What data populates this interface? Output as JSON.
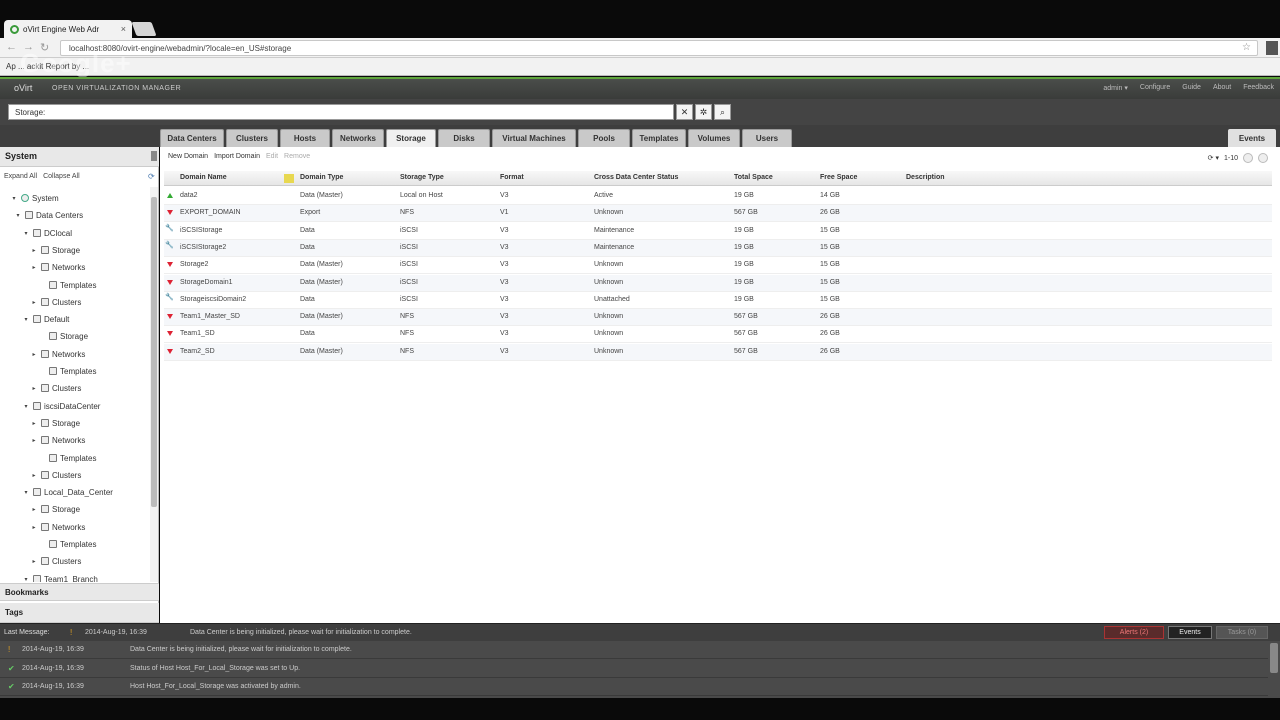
{
  "browser": {
    "tab_title": "oVirt Engine Web Adr",
    "tab_close": "×",
    "url": "localhost:8080/ovirt-engine/webadmin/?locale=en_US#storage",
    "bookmark_bar_text": "Ap  ...  ackit Report by ...",
    "overlay_text": "Google+"
  },
  "header": {
    "logo": "oVirt",
    "product": "OPEN VIRTUALIZATION MANAGER",
    "links": [
      "admin ▾",
      "Configure",
      "Guide",
      "About",
      "Feedback"
    ]
  },
  "search": {
    "value": "Storage:",
    "clear": "✕",
    "bookmark": "✲",
    "go": "⌕"
  },
  "main_tabs": [
    "Data Centers",
    "Clusters",
    "Hosts",
    "Networks",
    "Storage",
    "Disks",
    "Virtual Machines",
    "Pools",
    "Templates",
    "Volumes",
    "Users"
  ],
  "events_tab": "Events",
  "left": {
    "title": "System",
    "expand_all": "Expand All",
    "collapse_all": "Collapse All",
    "tree": [
      {
        "label": "System",
        "arrow": "▾"
      },
      {
        "label": "Data Centers",
        "arrow": "▾"
      },
      {
        "label": "DClocal",
        "arrow": "▾"
      },
      {
        "label": "Storage",
        "arrow": "▸"
      },
      {
        "label": "Networks",
        "arrow": "▸"
      },
      {
        "label": "Templates",
        "arrow": ""
      },
      {
        "label": "Clusters",
        "arrow": "▸"
      },
      {
        "label": "Default",
        "arrow": "▾"
      },
      {
        "label": "Storage",
        "arrow": ""
      },
      {
        "label": "Networks",
        "arrow": "▸"
      },
      {
        "label": "Templates",
        "arrow": ""
      },
      {
        "label": "Clusters",
        "arrow": "▸"
      },
      {
        "label": "iscsiDataCenter",
        "arrow": "▾"
      },
      {
        "label": "Storage",
        "arrow": "▸"
      },
      {
        "label": "Networks",
        "arrow": "▸"
      },
      {
        "label": "Templates",
        "arrow": ""
      },
      {
        "label": "Clusters",
        "arrow": "▸"
      },
      {
        "label": "Local_Data_Center",
        "arrow": "▾"
      },
      {
        "label": "Storage",
        "arrow": "▸"
      },
      {
        "label": "Networks",
        "arrow": "▸"
      },
      {
        "label": "Templates",
        "arrow": ""
      },
      {
        "label": "Clusters",
        "arrow": "▸"
      },
      {
        "label": "Team1_Branch",
        "arrow": "▾"
      }
    ],
    "bookmarks": "Bookmarks",
    "tags": "Tags"
  },
  "actions": {
    "new_domain": "New Domain",
    "import_domain": "Import Domain",
    "edit": "Edit",
    "remove": "Remove"
  },
  "pager": {
    "refresh": "⟳ ▾",
    "range": "1-10"
  },
  "grid": {
    "columns": [
      "Domain Name",
      "Domain Type",
      "Storage Type",
      "Format",
      "Cross Data Center Status",
      "Total Space",
      "Free Space",
      "Description"
    ],
    "rows": [
      {
        "status": "up",
        "name": "data2",
        "type": "Data (Master)",
        "storage": "Local on Host",
        "format": "V3",
        "cross": "Active",
        "total": "19 GB",
        "free": "14 GB",
        "desc": ""
      },
      {
        "status": "down",
        "name": "EXPORT_DOMAIN",
        "type": "Export",
        "storage": "NFS",
        "format": "V1",
        "cross": "Unknown",
        "total": "567 GB",
        "free": "26 GB",
        "desc": ""
      },
      {
        "status": "wrench",
        "name": "iSCSIStorage",
        "type": "Data",
        "storage": "iSCSI",
        "format": "V3",
        "cross": "Maintenance",
        "total": "19 GB",
        "free": "15 GB",
        "desc": ""
      },
      {
        "status": "wrench",
        "name": "iSCSIStorage2",
        "type": "Data",
        "storage": "iSCSI",
        "format": "V3",
        "cross": "Maintenance",
        "total": "19 GB",
        "free": "15 GB",
        "desc": ""
      },
      {
        "status": "down",
        "name": "Storage2",
        "type": "Data (Master)",
        "storage": "iSCSI",
        "format": "V3",
        "cross": "Unknown",
        "total": "19 GB",
        "free": "15 GB",
        "desc": ""
      },
      {
        "status": "down",
        "name": "StorageDomain1",
        "type": "Data (Master)",
        "storage": "iSCSI",
        "format": "V3",
        "cross": "Unknown",
        "total": "19 GB",
        "free": "15 GB",
        "desc": ""
      },
      {
        "status": "wrench",
        "name": "StorageiscsiDomain2",
        "type": "Data",
        "storage": "iSCSI",
        "format": "V3",
        "cross": "Unattached",
        "total": "19 GB",
        "free": "15 GB",
        "desc": ""
      },
      {
        "status": "down",
        "name": "Team1_Master_SD",
        "type": "Data (Master)",
        "storage": "NFS",
        "format": "V3",
        "cross": "Unknown",
        "total": "567 GB",
        "free": "26 GB",
        "desc": ""
      },
      {
        "status": "down",
        "name": "Team1_SD",
        "type": "Data",
        "storage": "NFS",
        "format": "V3",
        "cross": "Unknown",
        "total": "567 GB",
        "free": "26 GB",
        "desc": ""
      },
      {
        "status": "down",
        "name": "Team2_SD",
        "type": "Data (Master)",
        "storage": "NFS",
        "format": "V3",
        "cross": "Unknown",
        "total": "567 GB",
        "free": "26 GB",
        "desc": ""
      }
    ]
  },
  "status_bar": {
    "label": "Last Message:",
    "time": "2014-Aug-19, 16:39",
    "text": "Data Center is being initialized, please wait for initialization to complete.",
    "alerts": "Alerts (2)",
    "events": "Events",
    "tasks": "Tasks (0)"
  },
  "events": [
    {
      "level": "warn",
      "time": "2014-Aug-19, 16:39",
      "text": "Data Center is being initialized, please wait for initialization to complete."
    },
    {
      "level": "ok",
      "time": "2014-Aug-19, 16:39",
      "text": "Status of Host Host_For_Local_Storage was set to Up."
    },
    {
      "level": "ok",
      "time": "2014-Aug-19, 16:39",
      "text": "Host Host_For_Local_Storage was activated by admin."
    }
  ]
}
